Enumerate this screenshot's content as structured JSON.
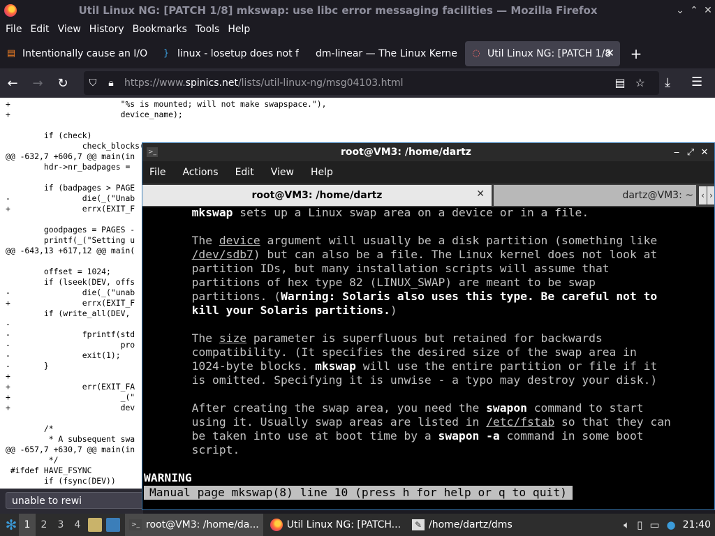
{
  "firefox": {
    "window_title": "Util Linux NG: [PATCH 1/8] mkswap: use libc error messaging facilities — Mozilla Firefox",
    "menu": [
      "File",
      "Edit",
      "View",
      "History",
      "Bookmarks",
      "Tools",
      "Help"
    ],
    "tabs": [
      {
        "label": "Intentionally cause an I/O"
      },
      {
        "label": "linux - losetup does not f"
      },
      {
        "label": "dm-linear — The Linux Kerne"
      },
      {
        "label": "Util Linux NG: [PATCH 1/8"
      }
    ],
    "url": {
      "prefix": "https://www.",
      "domain": "spinics.net",
      "path": "/lists/util-linux-ng/msg04103.html"
    },
    "page_text": "+                       \"%s is mounted; will not make swapspace.\"),\n+                       device_name);\n\n        if (check)\n                check_blocks();\n@@ -632,7 +606,7 @@ main(in\n        hdr->nr_badpages = \n\n        if (badpages > PAGE\n-               die(_(\"Unab\n+               errx(EXIT_F\n\n        goodpages = PAGES -\n        printf(_(\"Setting u\n@@ -643,13 +617,12 @@ main(\n\n        offset = 1024;\n        if (lseek(DEV, offs\n-               die(_(\"unab\n+               errx(EXIT_F\n        if (write_all(DEV,\n-\n-               fprintf(std\n-                       pro\n-               exit(1);\n-       }\n+\n+               err(EXIT_FA\n+                       _(\"\n+                       dev\n\n        /*\n         * A subsequent swa\n@@ -657,7 +630,7 @@ main(in\n         */\n #ifdef HAVE_FSYNC\n        if (fsync(DEV))",
    "find_text": "unable to rewi"
  },
  "terminal": {
    "title": "root@VM3: /home/dartz",
    "menu": [
      "File",
      "Actions",
      "Edit",
      "View",
      "Help"
    ],
    "tabs": [
      {
        "label": "root@VM3: /home/dartz"
      },
      {
        "label": "dartz@VM3: ~"
      }
    ],
    "man": {
      "l1a": "mkswap",
      "l1b": " sets up a Linux swap area on a device or in a file.",
      "p2_1a": "The ",
      "p2_1b": "device",
      "p2_1c": " argument will usually be a disk partition (something like",
      "p2_2a": "/dev/sdb7",
      "p2_2b": ") but can also be a file. The Linux kernel does not look at",
      "p2_3": "partition IDs, but many installation scripts will assume that",
      "p2_4": "partitions of hex type 82 (LINUX_SWAP) are meant to be swap",
      "p2_5a": "partitions. (",
      "p2_5b": "Warning: Solaris also uses this type. Be careful not to",
      "p2_6a": "kill your Solaris partitions.",
      "p2_6b": ")",
      "p3_1a": "The ",
      "p3_1b": "size",
      "p3_1c": " parameter is superfluous but retained for backwards",
      "p3_2": "compatibility. (It specifies the desired size of the swap area in",
      "p3_3a": "1024-byte blocks. ",
      "p3_3b": "mkswap",
      "p3_3c": " will use the entire partition or file if it",
      "p3_4": "is omitted. Specifying it is unwise - a typo may destroy your disk.)",
      "p4_1a": "After creating the swap area, you need the ",
      "p4_1b": "swapon",
      "p4_1c": " command to start",
      "p4_2a": "using it. Usually swap areas are listed in ",
      "p4_2b": "/etc/fstab",
      "p4_2c": " so that they can",
      "p4_3a": "be taken into use at boot time by a ",
      "p4_3b": "swapon -a",
      "p4_3c": " command in some boot",
      "p4_4": "script.",
      "warning": "WARNING",
      "status": "Manual page mkswap(8) line 10 (press h for help or q to quit)"
    }
  },
  "panel": {
    "workspaces": [
      "1",
      "2",
      "3",
      "4"
    ],
    "tasks": [
      {
        "label": "root@VM3: /home/da..."
      },
      {
        "label": "Util Linux NG: [PATCH..."
      },
      {
        "label": "/home/dartz/dms"
      }
    ],
    "clock": "21:40"
  }
}
